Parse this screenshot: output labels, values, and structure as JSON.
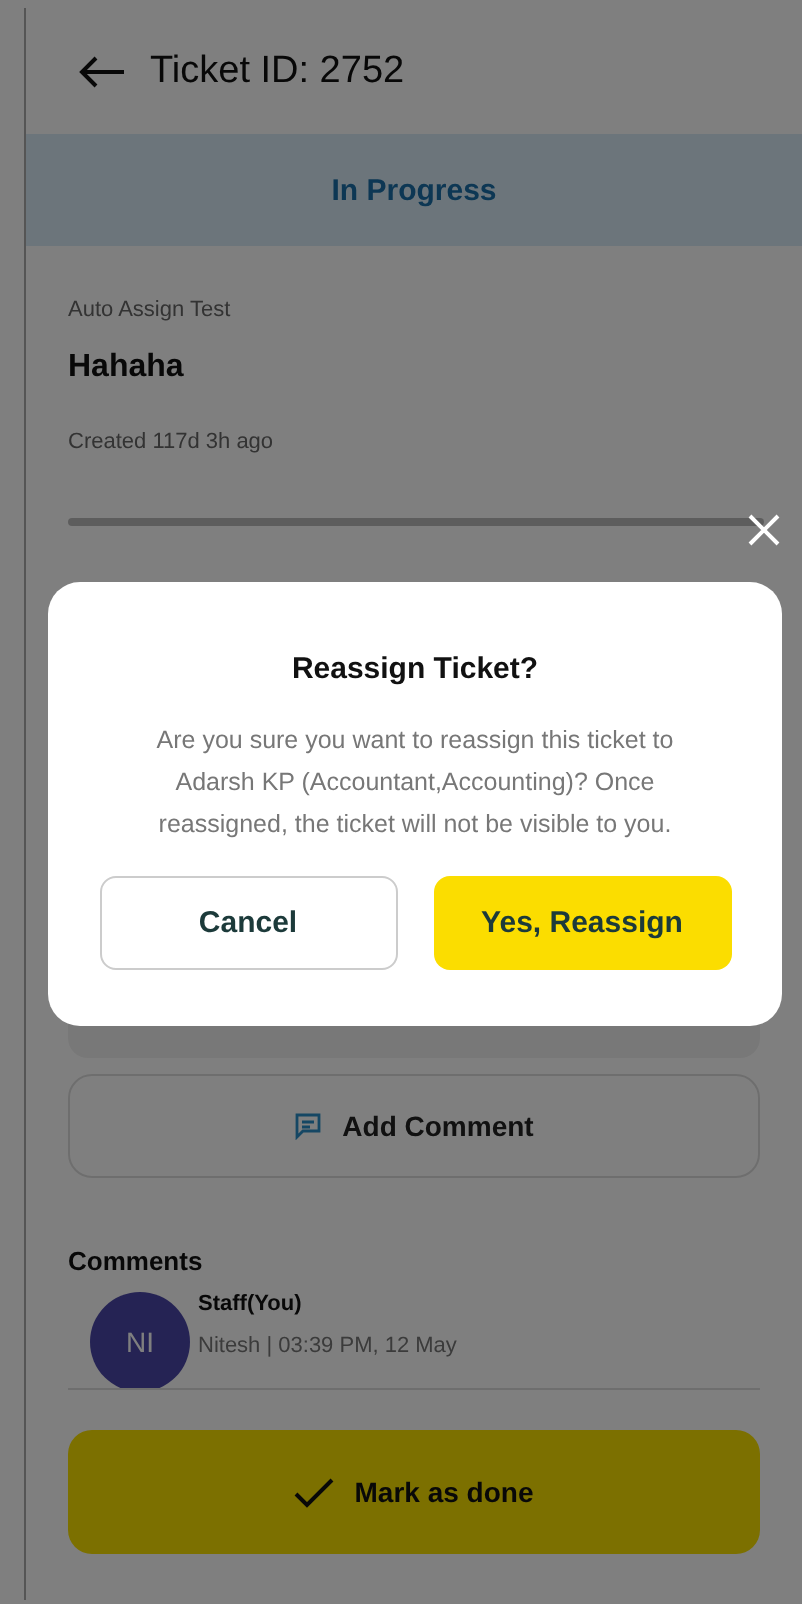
{
  "header": {
    "title": "Ticket ID: 2752"
  },
  "status": {
    "label": "In Progress"
  },
  "ticket": {
    "category": "Auto Assign Test",
    "title": "Hahaha",
    "created": "Created 117d 3h ago"
  },
  "add_comment": {
    "label": "Add Comment"
  },
  "comments": {
    "heading": "Comments",
    "items": [
      {
        "initials": "NI",
        "author": "Staff(You)",
        "meta": "Nitesh | 03:39 PM, 12 May"
      }
    ]
  },
  "mark_done": {
    "label": "Mark as done"
  },
  "dialog": {
    "title": "Reassign Ticket?",
    "message": "Are you sure you want to reassign this ticket to Adarsh KP (Accountant,Accounting)? Once reassigned, the ticket will not be visible to you.",
    "buttons": [
      {
        "label": "Cancel",
        "kind": "secondary"
      },
      {
        "label": "Yes, Reassign",
        "kind": "primary"
      }
    ]
  }
}
